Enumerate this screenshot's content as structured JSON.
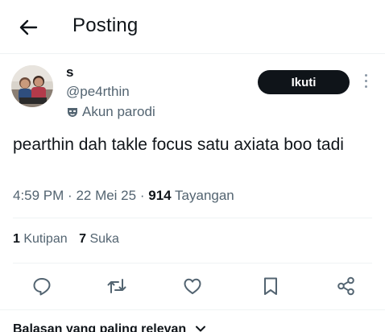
{
  "header": {
    "title": "Posting"
  },
  "author": {
    "name": "s",
    "handle": "@pe4rthin",
    "parody_label": "Akun parodi",
    "follow_label": "Ikuti"
  },
  "tweet": {
    "text": "pearthin dah takle focus satu axiata boo tadi",
    "time": "4:59 PM",
    "date": "22 Mei 25",
    "views_count": "914",
    "views_label": "Tayangan"
  },
  "stats": {
    "quotes_count": "1",
    "quotes_label": "Kutipan",
    "likes_count": "7",
    "likes_label": "Suka"
  },
  "sort": {
    "label": "Balasan yang paling relevan"
  },
  "icons": {
    "back": "arrow-left-icon",
    "parody": "mask-icon",
    "more": "more-vertical-icon",
    "reply": "reply-icon",
    "retweet": "retweet-icon",
    "like": "heart-icon",
    "bookmark": "bookmark-icon",
    "share": "share-icon"
  },
  "colors": {
    "text_primary": "#0f1419",
    "text_secondary": "#536471",
    "follow_button_bg": "#0f1419",
    "divider": "#eff3f4"
  }
}
